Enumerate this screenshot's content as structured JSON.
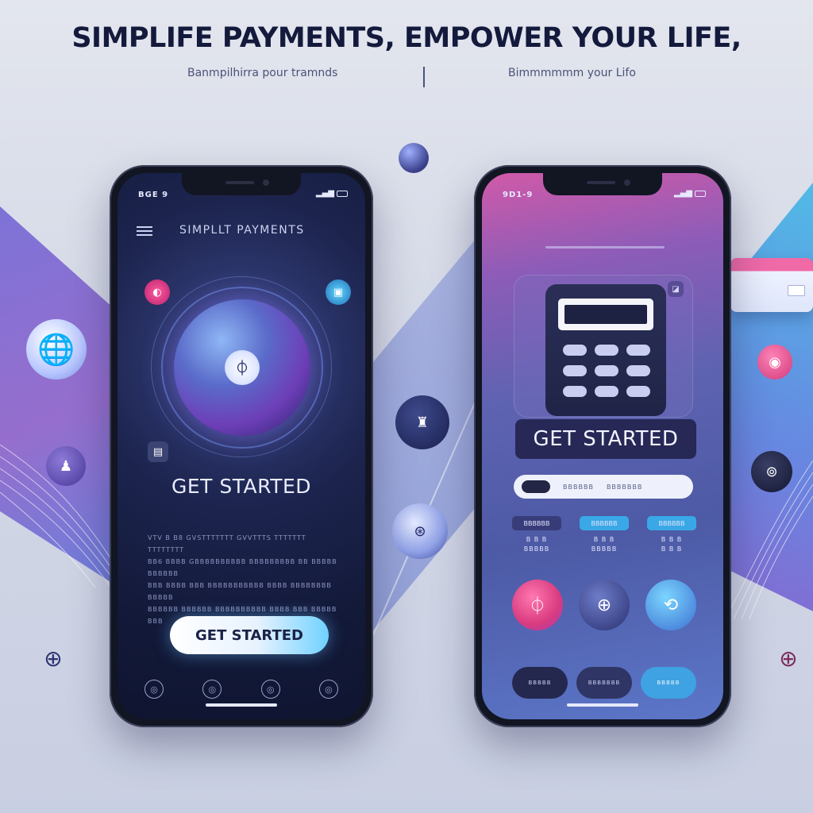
{
  "header": {
    "headline": "SIMPLIFE PAYMENTS, EMPOWER YOUR LIFE,",
    "sub_left": "Banmpilhirra pour tramnds",
    "sub_right": "Bimmmmmm your Lifo"
  },
  "phone_left": {
    "status_time": "BGE 9",
    "app_title": "SIMPLLT PAYMENTS",
    "heading": "GET STARTED",
    "body_lines": [
      "VTV B B8 GVSTTTTTTT GVVTTTS TTTTTTT TTTTTTTT",
      "BB6 BBBB GBBBBBBBBBB BBBBBBBBB BB BBBBB BBBBBB",
      "BBB BBBB BBB BBBBBBBBBBB BBBB BBBBBBBB BBBBB",
      "BBBBBB BBBBBB BBBBBBBBBB BBBB BBB BBBBB BBB"
    ],
    "cta_label": "GET STARTED",
    "globe_symbol": "⏀",
    "orb_labels": [
      "◐",
      "▣",
      "▤"
    ],
    "nav_icons": [
      "◎",
      "◎",
      "◎",
      "◎"
    ]
  },
  "phone_right": {
    "status_time": "9D1-9",
    "badge_label": "GET STARTED",
    "calc_corner": "◪",
    "search_text_1": "BBBBBB",
    "search_text_2": "BBBBBBB",
    "plans": [
      {
        "head": "BBBBBB",
        "line1": "B B B",
        "line2": "BBBBB"
      },
      {
        "head": "BBBBBB",
        "line1": "B B B",
        "line2": "BBBBB"
      },
      {
        "head": "BBBBBB",
        "line1": "B B B",
        "line2": "B B B"
      }
    ],
    "actions": [
      "⏀",
      "⊕",
      "⟲"
    ],
    "tabs": [
      "BBBBB",
      "BBBBBBB",
      "BBBBB"
    ]
  },
  "floating": {
    "globe_icon": "🌐",
    "profile_icon": "♟",
    "center_top_icon": "♜",
    "center_mid_icon": "⊛",
    "right_pink_icon": "◉",
    "right_dark_icon": "⊚",
    "crosshair": "⊕"
  },
  "colors": {
    "accent_pink": "#e2458f",
    "accent_blue": "#3fb7ee",
    "accent_purple": "#6d4fc7",
    "phone_dark": "#121522"
  }
}
